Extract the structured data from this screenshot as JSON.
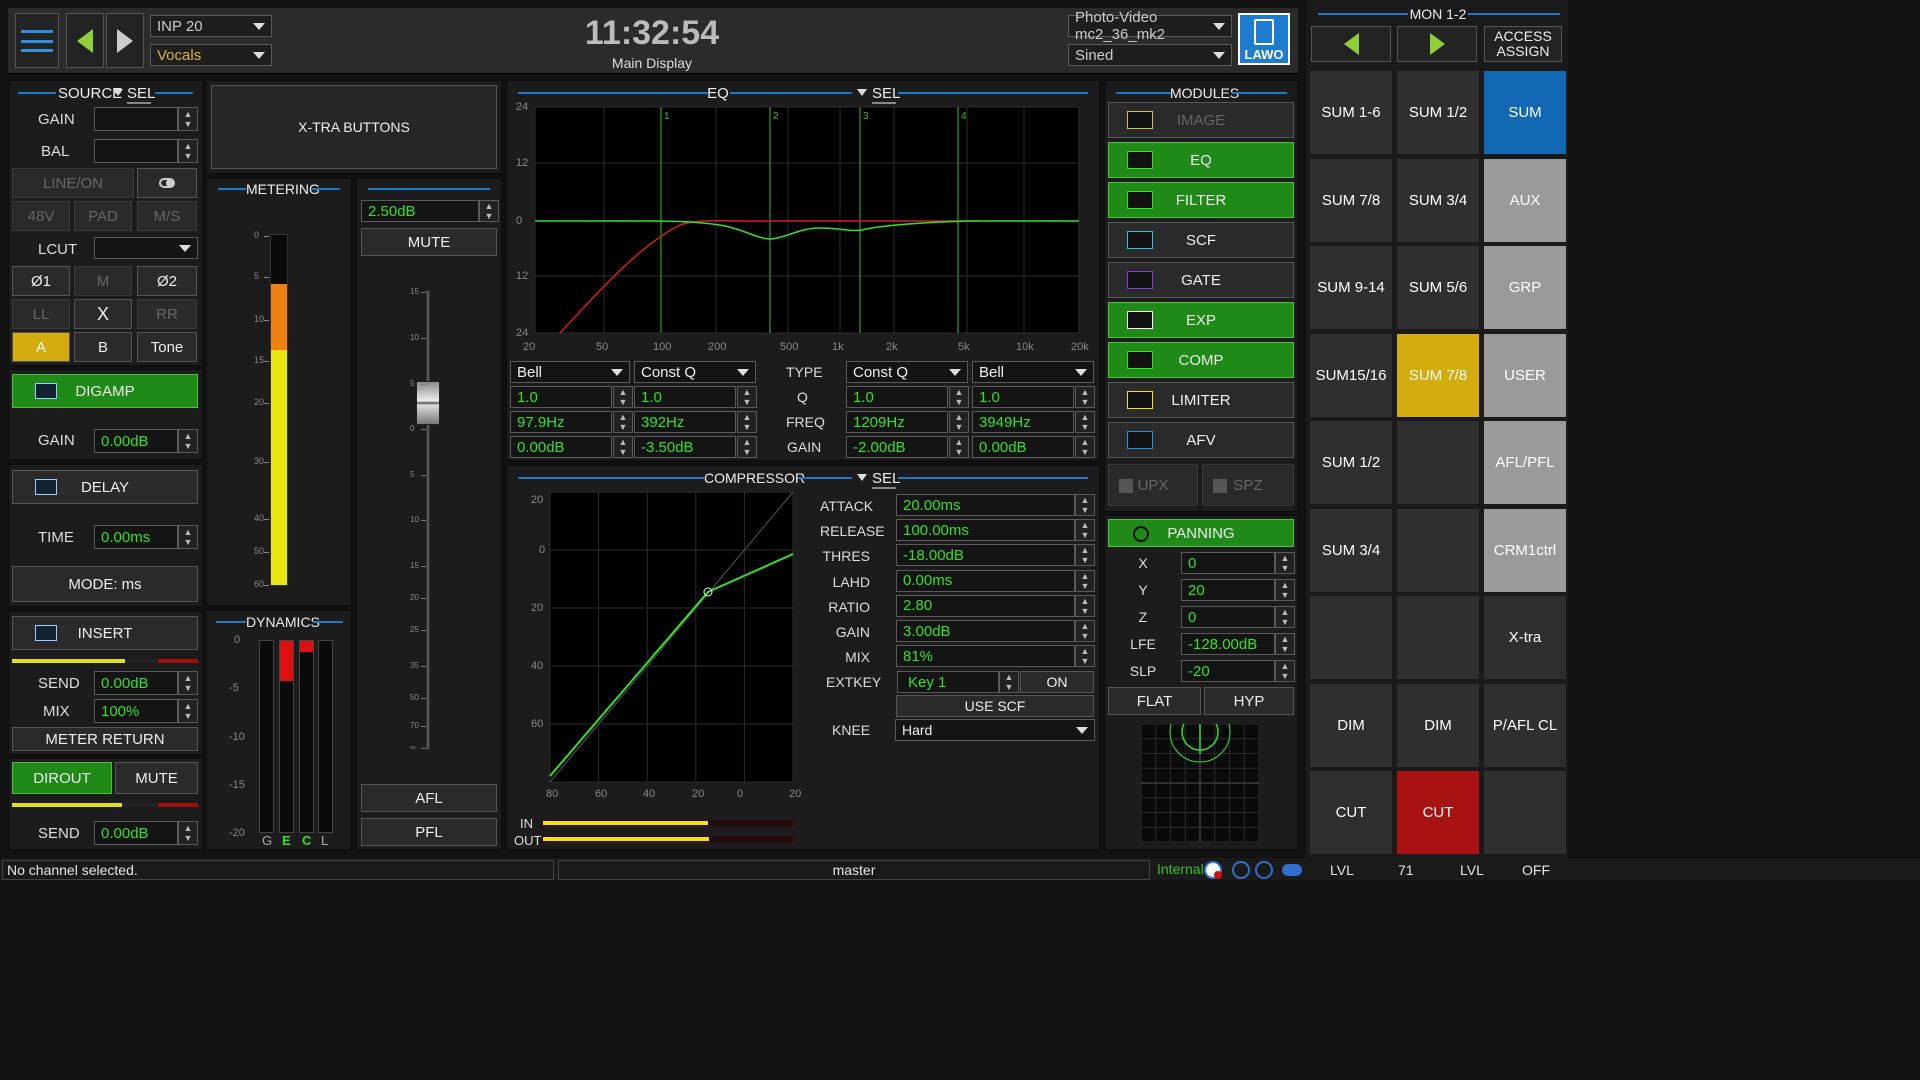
{
  "header": {
    "input_number": "INP  20",
    "channel_name": "Vocals",
    "clock": "11:32:54",
    "display_name": "Main Display",
    "production": "Photo-Video mc2_36_mk2",
    "user": "Sined",
    "logo": "LAWO"
  },
  "mon": {
    "title": "MON 1-2",
    "access_assign": "ACCESS ASSIGN",
    "grid": [
      [
        "SUM 1-6",
        "SUM 1/2",
        "SUM"
      ],
      [
        "SUM 7/8",
        "SUM 3/4",
        "AUX"
      ],
      [
        "SUM 9-14",
        "SUM 5/6",
        "GRP"
      ],
      [
        "SUM15/16",
        "SUM 7/8",
        "USER"
      ],
      [
        "SUM 1/2",
        "",
        "AFL/PFL"
      ],
      [
        "SUM 3/4",
        "",
        "CRM1ctrl"
      ],
      [
        "",
        "",
        "X-tra"
      ],
      [
        "DIM",
        "DIM",
        "P/AFL CL"
      ],
      [
        "CUT",
        "CUT",
        ""
      ]
    ]
  },
  "source": {
    "title": "SOURCE",
    "sel": "SEL",
    "gain_label": "GAIN",
    "bal_label": "BAL",
    "line_on": "LINE/ON",
    "v48": "48V",
    "pad": "PAD",
    "ms": "M/S",
    "lcut": "LCUT",
    "phase1": "Ø1",
    "m": "M",
    "phase2": "Ø2",
    "ll": "LL",
    "x": "X",
    "rr": "RR",
    "a": "A",
    "b": "B",
    "tone": "Tone"
  },
  "digamp": {
    "label": "DIGAMP",
    "gain_label": "GAIN",
    "gain": "0.00dB"
  },
  "delay": {
    "label": "DELAY",
    "time_label": "TIME",
    "time": "0.00ms",
    "mode": "MODE: ms"
  },
  "insert": {
    "label": "INSERT",
    "send_label": "SEND",
    "send": "0.00dB",
    "mix_label": "MIX",
    "mix": "100%",
    "meter_return": "METER RETURN"
  },
  "dirout": {
    "label": "DIROUT",
    "mute": "MUTE",
    "send_label": "SEND",
    "send": "0.00dB"
  },
  "xtra": {
    "label": "X-TRA BUTTONS"
  },
  "metering": {
    "title": "METERING",
    "scale": [
      "0",
      "5",
      "10",
      "15",
      "20",
      "30",
      "40",
      "50",
      "60"
    ],
    "level_fraction": 0.86
  },
  "fader": {
    "value": "2.50dB",
    "mute": "MUTE",
    "scale": [
      "15",
      "10",
      "5",
      "0",
      "5",
      "10",
      "15",
      "20",
      "25",
      "35",
      "50",
      "70",
      "∞"
    ],
    "afl": "AFL",
    "pfl": "PFL"
  },
  "dynamics": {
    "title": "DYNAMICS",
    "scale": [
      "0",
      "-5",
      "-10",
      "-15",
      "-20"
    ],
    "labels": [
      "G",
      "E",
      "C",
      "L"
    ]
  },
  "eq": {
    "title": "EQ",
    "sel": "SEL",
    "y_ticks": [
      "24",
      "12",
      "0",
      "12",
      "24"
    ],
    "x_ticks": [
      "20",
      "50",
      "100",
      "200",
      "500",
      "1k",
      "2k",
      "5k",
      "10k",
      "20k"
    ],
    "band_markers": [
      "1",
      "2",
      "3",
      "4"
    ],
    "row_labels": [
      "TYPE",
      "Q",
      "FREQ",
      "GAIN"
    ],
    "bands": [
      {
        "type": "Bell",
        "q": "1.0",
        "freq": "97.9Hz",
        "gain": "0.00dB"
      },
      {
        "type": "Const Q",
        "q": "1.0",
        "freq": "392Hz",
        "gain": "-3.50dB"
      },
      {
        "type": "Const Q",
        "q": "1.0",
        "freq": "1209Hz",
        "gain": "-2.00dB"
      },
      {
        "type": "Bell",
        "q": "1.0",
        "freq": "3949Hz",
        "gain": "0.00dB"
      }
    ],
    "colors": {
      "curve": "#33e02a",
      "filter": "#d42020",
      "marker": "#33c02a"
    }
  },
  "compressor": {
    "title": "COMPRESSOR",
    "sel": "SEL",
    "y_ticks": [
      "20",
      "0",
      "20",
      "40",
      "60"
    ],
    "x_ticks": [
      "80",
      "60",
      "40",
      "20",
      "0",
      "20"
    ],
    "params": [
      {
        "label": "ATTACK",
        "value": "20.00ms"
      },
      {
        "label": "RELEASE",
        "value": "100.00ms"
      },
      {
        "label": "THRES",
        "value": "-18.00dB"
      },
      {
        "label": "LAHD",
        "value": "0.00ms"
      },
      {
        "label": "RATIO",
        "value": "2.80"
      },
      {
        "label": "GAIN",
        "value": "3.00dB"
      },
      {
        "label": "MIX",
        "value": "81%"
      }
    ],
    "extkey_label": "EXTKEY",
    "extkey": "Key  1",
    "on": "ON",
    "use_scf": "USE SCF",
    "knee_label": "KNEE",
    "knee": "Hard",
    "in_label": "IN",
    "out_label": "OUT"
  },
  "modules": {
    "title": "MODULES",
    "items": [
      "IMAGE",
      "EQ",
      "FILTER",
      "SCF",
      "GATE",
      "EXP",
      "COMP",
      "LIMITER",
      "AFV"
    ],
    "upx": "UPX",
    "spz": "SPZ"
  },
  "panning": {
    "label": "PANNING",
    "params": [
      {
        "label": "X",
        "value": "0"
      },
      {
        "label": "Y",
        "value": "20"
      },
      {
        "label": "Z",
        "value": "0"
      },
      {
        "label": "LFE",
        "value": "-128.00dB"
      },
      {
        "label": "SLP",
        "value": "-20"
      }
    ],
    "flat": "FLAT",
    "hyp": "HYP"
  },
  "status": {
    "message": "No channel selected.",
    "master": "master",
    "sync": "Internal",
    "lvl1": "LVL",
    "val1": "71",
    "lvl2": "LVL",
    "val2": "OFF"
  }
}
